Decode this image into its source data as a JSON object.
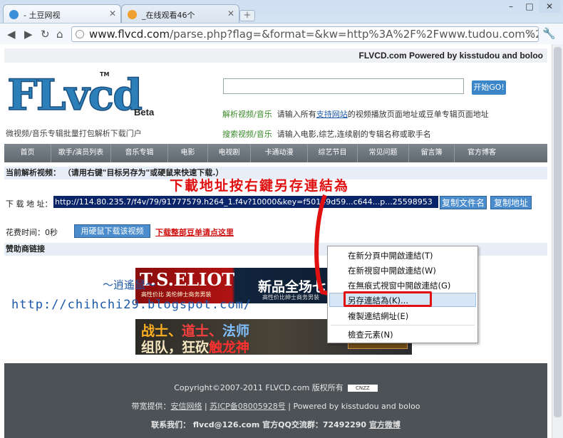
{
  "browser": {
    "tabs": [
      {
        "title": "- 土豆网视",
        "active": true
      },
      {
        "title": "_在线观看46个",
        "active": false
      }
    ],
    "address": {
      "host": "www.flvcd.com",
      "path": "/parse.php?flag=&format=&kw=http%3A%2F%2Fwww.tudou.com%2Fp"
    },
    "window_buttons": [
      "–",
      "□",
      "✕"
    ]
  },
  "page": {
    "top_bar": "FLVCD.com Powered by kisstudou and boloo",
    "logo": {
      "text": "FLvcd",
      "tm": "TM",
      "beta": "Beta"
    },
    "tagline": "微视频/音乐专辑批量打包解析下载门户",
    "search": {
      "go_button": "开始GO!"
    },
    "hint1": {
      "label": "解析视频/音乐",
      "text_before": "请输入所有",
      "link": "支持网站",
      "text_after": "的视频播放页面地址或豆单专辑页面地址"
    },
    "hint2": {
      "label": "搜索视频/音乐",
      "text": "请输入电影,综艺,连续剧的专辑名称或歌手名"
    },
    "nav": [
      "首页",
      "歌手/演员列表",
      "音乐专辑",
      "电影",
      "电视剧",
      "卡通动漫",
      "综艺节目",
      "常见问题",
      "留言簿",
      "官方博客"
    ],
    "parse_heading": "当前解析视频：              （请用右键\"目标另存为\"或硬鼠来快速下载.）",
    "red_title": "下載地址按右鍵另存連結為",
    "address_label": "下 载 地 址：",
    "address_value": "http://114.80.235.7/f4v/79/91777579.h264_1.f4v?10000&key=f50149d59...c644...p...25598953",
    "copy_name_button": "复制文件名",
    "copy_addr_button": "复制地址",
    "time_label": "花费时间：0秒",
    "download_button": "用硬鼠下载该视频",
    "download_page_link": "下载整部豆单请点这里",
    "sponsor_heading": "赞助商链接",
    "ad1": {
      "brand": "T.S.ELIOT",
      "sub": "高性价比  英伦绅士商务男装",
      "cn": "新品全场七",
      "cn2": "高性价比绅士商务男装"
    },
    "ad2": {
      "line1_a": "战士、",
      "line1_b": "道士、",
      "line1_c": "法师",
      "line2_a": "组队，狂砍",
      "line2_b": "触龙神",
      "badge": "【城主】"
    },
    "watermark1": "～逍遙鼠～",
    "watermark2": "http://chihchi29.blogspot.com/",
    "footer": {
      "copyright": "Copyright©2007-2011 FLVCD.com 版权所有",
      "cnzz": "CNZZ",
      "bandwidth_prefix": "带宽提供：",
      "bandwidth_link": "安信网络",
      "icp": "苏ICP备08005928号",
      "powered": "| Powered by kisstudou and boloo",
      "contact": "联系我们：  flvcd@126.com  官方QQ交流群：72492290",
      "weibo": "官方微博"
    }
  },
  "context_menu": {
    "items": [
      "在新分頁中開啟連結(T)",
      "在新視窗中開啟連結(W)",
      "在無痕式視窗中開啟連結(G)",
      "另存連結為(K)...",
      "複製連結網址(E)",
      "檢查元素(N)"
    ],
    "highlighted_index": 3
  },
  "colors": {
    "accent_red": "#e01010",
    "link_blue": "#1a57a8",
    "nav_gray": "#6a727a"
  }
}
